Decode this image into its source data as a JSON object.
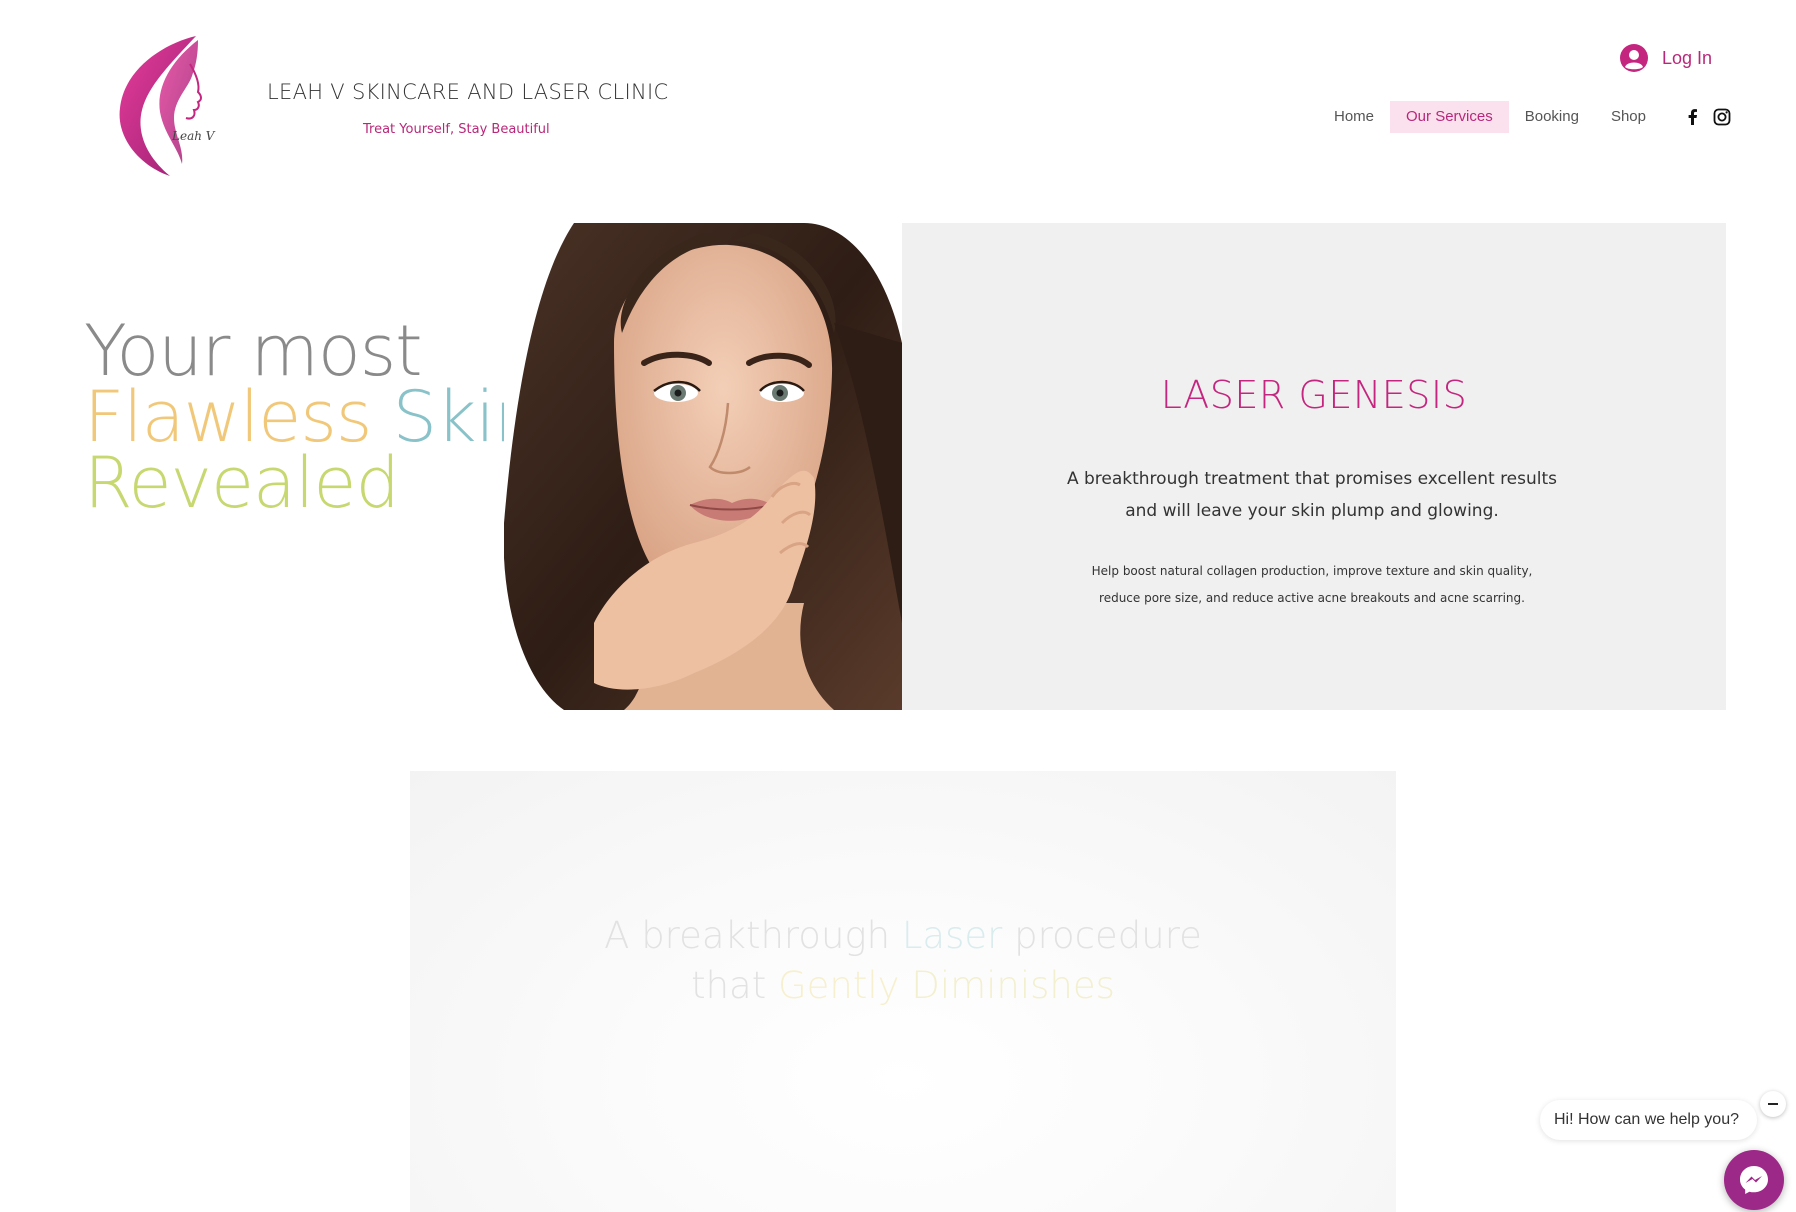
{
  "header": {
    "brand_title": "LEAH V SKINCARE AND LASER CLINIC",
    "tagline": "Treat Yourself, Stay Beautiful",
    "logo_icon": "woman-profile-logo",
    "logo_script": "Leah V",
    "login_label": "Log In",
    "login_icon": "user-avatar-icon"
  },
  "nav": {
    "items": [
      {
        "label": "Home"
      },
      {
        "label": "Our Services"
      },
      {
        "label": "Booking"
      },
      {
        "label": "Shop"
      }
    ],
    "active": "Our Services",
    "social": [
      "facebook-icon",
      "instagram-icon"
    ]
  },
  "hero": {
    "line1": "Your most",
    "word_flawless": "Flawless",
    "word_skin": "Skin",
    "word_revealed": "Revealed",
    "photo": "woman-portrait-photo"
  },
  "panel": {
    "title": "LASER GENESIS",
    "lead_1": "A breakthrough treatment that promises excellent results",
    "lead_2": "and will leave your skin plump and glowing.",
    "detail_1": "Help boost natural collagen production, improve texture and skin quality,",
    "detail_2": "reduce pore size, and reduce active acne breakouts and acne scarring."
  },
  "section2": {
    "part_a": "A breakthrough",
    "word_laser": "Laser",
    "part_b": "procedure",
    "part_c": "that",
    "word_gently": "Gently",
    "word_diminishes": "Diminishes"
  },
  "chat": {
    "greeting": "Hi! How can we help you?",
    "launcher_icon": "messenger-icon",
    "close_icon": "minimize-icon"
  },
  "colors": {
    "brand_pink": "#c4267f",
    "nav_active_bg": "#fbe1ee",
    "panel_bg": "#f0f0f0",
    "chat_purple": "#9c2887",
    "flawless_gold": "#f1c879",
    "skin_teal": "#89c3c9",
    "revealed_lime": "#c6d86f"
  }
}
